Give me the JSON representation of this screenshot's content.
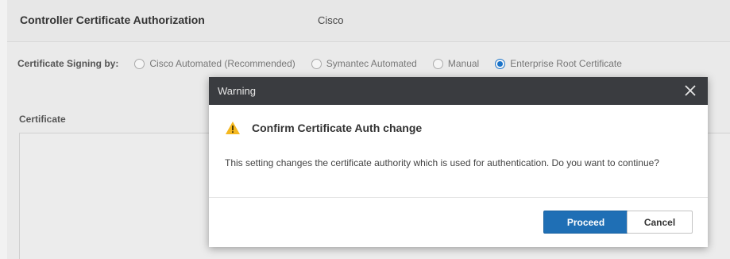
{
  "header": {
    "title": "Controller Certificate Authorization",
    "value": "Cisco"
  },
  "signing": {
    "label": "Certificate Signing by:",
    "options": [
      {
        "label": "Cisco Automated (Recommended)",
        "selected": false
      },
      {
        "label": "Symantec Automated",
        "selected": false
      },
      {
        "label": "Manual",
        "selected": false
      },
      {
        "label": "Enterprise Root Certificate",
        "selected": true
      }
    ]
  },
  "certificate": {
    "label": "Certificate"
  },
  "modal": {
    "title": "Warning",
    "close_icon": "close-icon",
    "heading": "Confirm Certificate Auth change",
    "warning_icon": "warning-icon",
    "message": "This setting changes the certificate authority which is used for authentication. Do you want to continue?",
    "proceed_label": "Proceed",
    "cancel_label": "Cancel"
  },
  "colors": {
    "primary": "#1f6fb5",
    "modal_header": "#3a3c40",
    "warning": "#f5b820"
  }
}
